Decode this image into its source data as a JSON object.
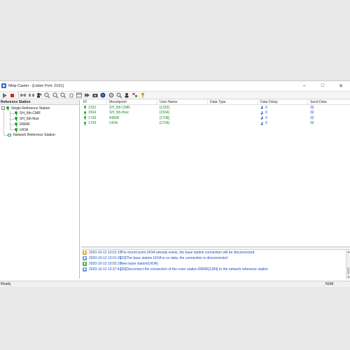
{
  "window": {
    "title": "Ntrip Caster - [Listen Port: 2101]",
    "controls": {
      "minimize": "–",
      "maximize": "□",
      "close": "✕"
    }
  },
  "toolbar": {
    "icons": [
      "play-icon",
      "stop-icon",
      "connect-icon",
      "disconnect-icon",
      "users-icon",
      "zoom-in-icon",
      "zoom-out-icon",
      "zoom-fit-icon",
      "hand-icon",
      "window-icon",
      "forward-icon",
      "camera-icon",
      "globe-icon",
      "settings-icon",
      "search-icon",
      "person-icon",
      "flags-icon",
      "key-icon"
    ]
  },
  "colors": {
    "accent": "#1a4fbf",
    "green": "#1c8a2c",
    "stop": "#e02020"
  },
  "tree": {
    "header": "Reference Station",
    "single_group": "Single Reference Station",
    "stations": [
      "SH_5th-CMR",
      "SH_5th-floor",
      "RRRR",
      "UIOA"
    ],
    "network_group": "Network Reference Station",
    "expander": "-"
  },
  "grid": {
    "columns": [
      "ID",
      "Mountpoint",
      "User Name",
      "Data Type",
      "Data Delay",
      "Send Data"
    ],
    "rows": [
      {
        "id": "1332",
        "mountpoint": "SH_5th-CMR",
        "user": "[1332]",
        "type": "",
        "delay": "0",
        "send": "32"
      },
      {
        "id": "1564",
        "mountpoint": "SH_5th-floor",
        "user": "[1564]",
        "type": "",
        "delay": "0",
        "send": "32"
      },
      {
        "id": "1708",
        "mountpoint": "RRRR",
        "user": "[1708]",
        "type": "",
        "delay": "0",
        "send": "32"
      },
      {
        "id": "1704",
        "mountpoint": "UIOA",
        "user": "[1704]",
        "type": "",
        "delay": "0",
        "send": "32"
      }
    ]
  },
  "log": [
    {
      "kind": "warn",
      "time": "2020-10-12 10:01:15",
      "message": "The mount point UIOA already exists, the base station connection will be disconnected."
    },
    {
      "kind": "info",
      "time": "2020-10-12 10:01:35",
      "message": "[23]The base station UIOA is no data, the connection is disconnected"
    },
    {
      "kind": "ok",
      "time": "2020-10-12 10:02:10",
      "message": "New base station(UIOA)"
    },
    {
      "kind": "info",
      "time": "2020-10-12 10:37:42",
      "message": "[20]Disconnect the connection of the rover station RRRR[1384] to the network reference station"
    }
  ],
  "status": {
    "left": "Ready",
    "right": "NUM"
  }
}
